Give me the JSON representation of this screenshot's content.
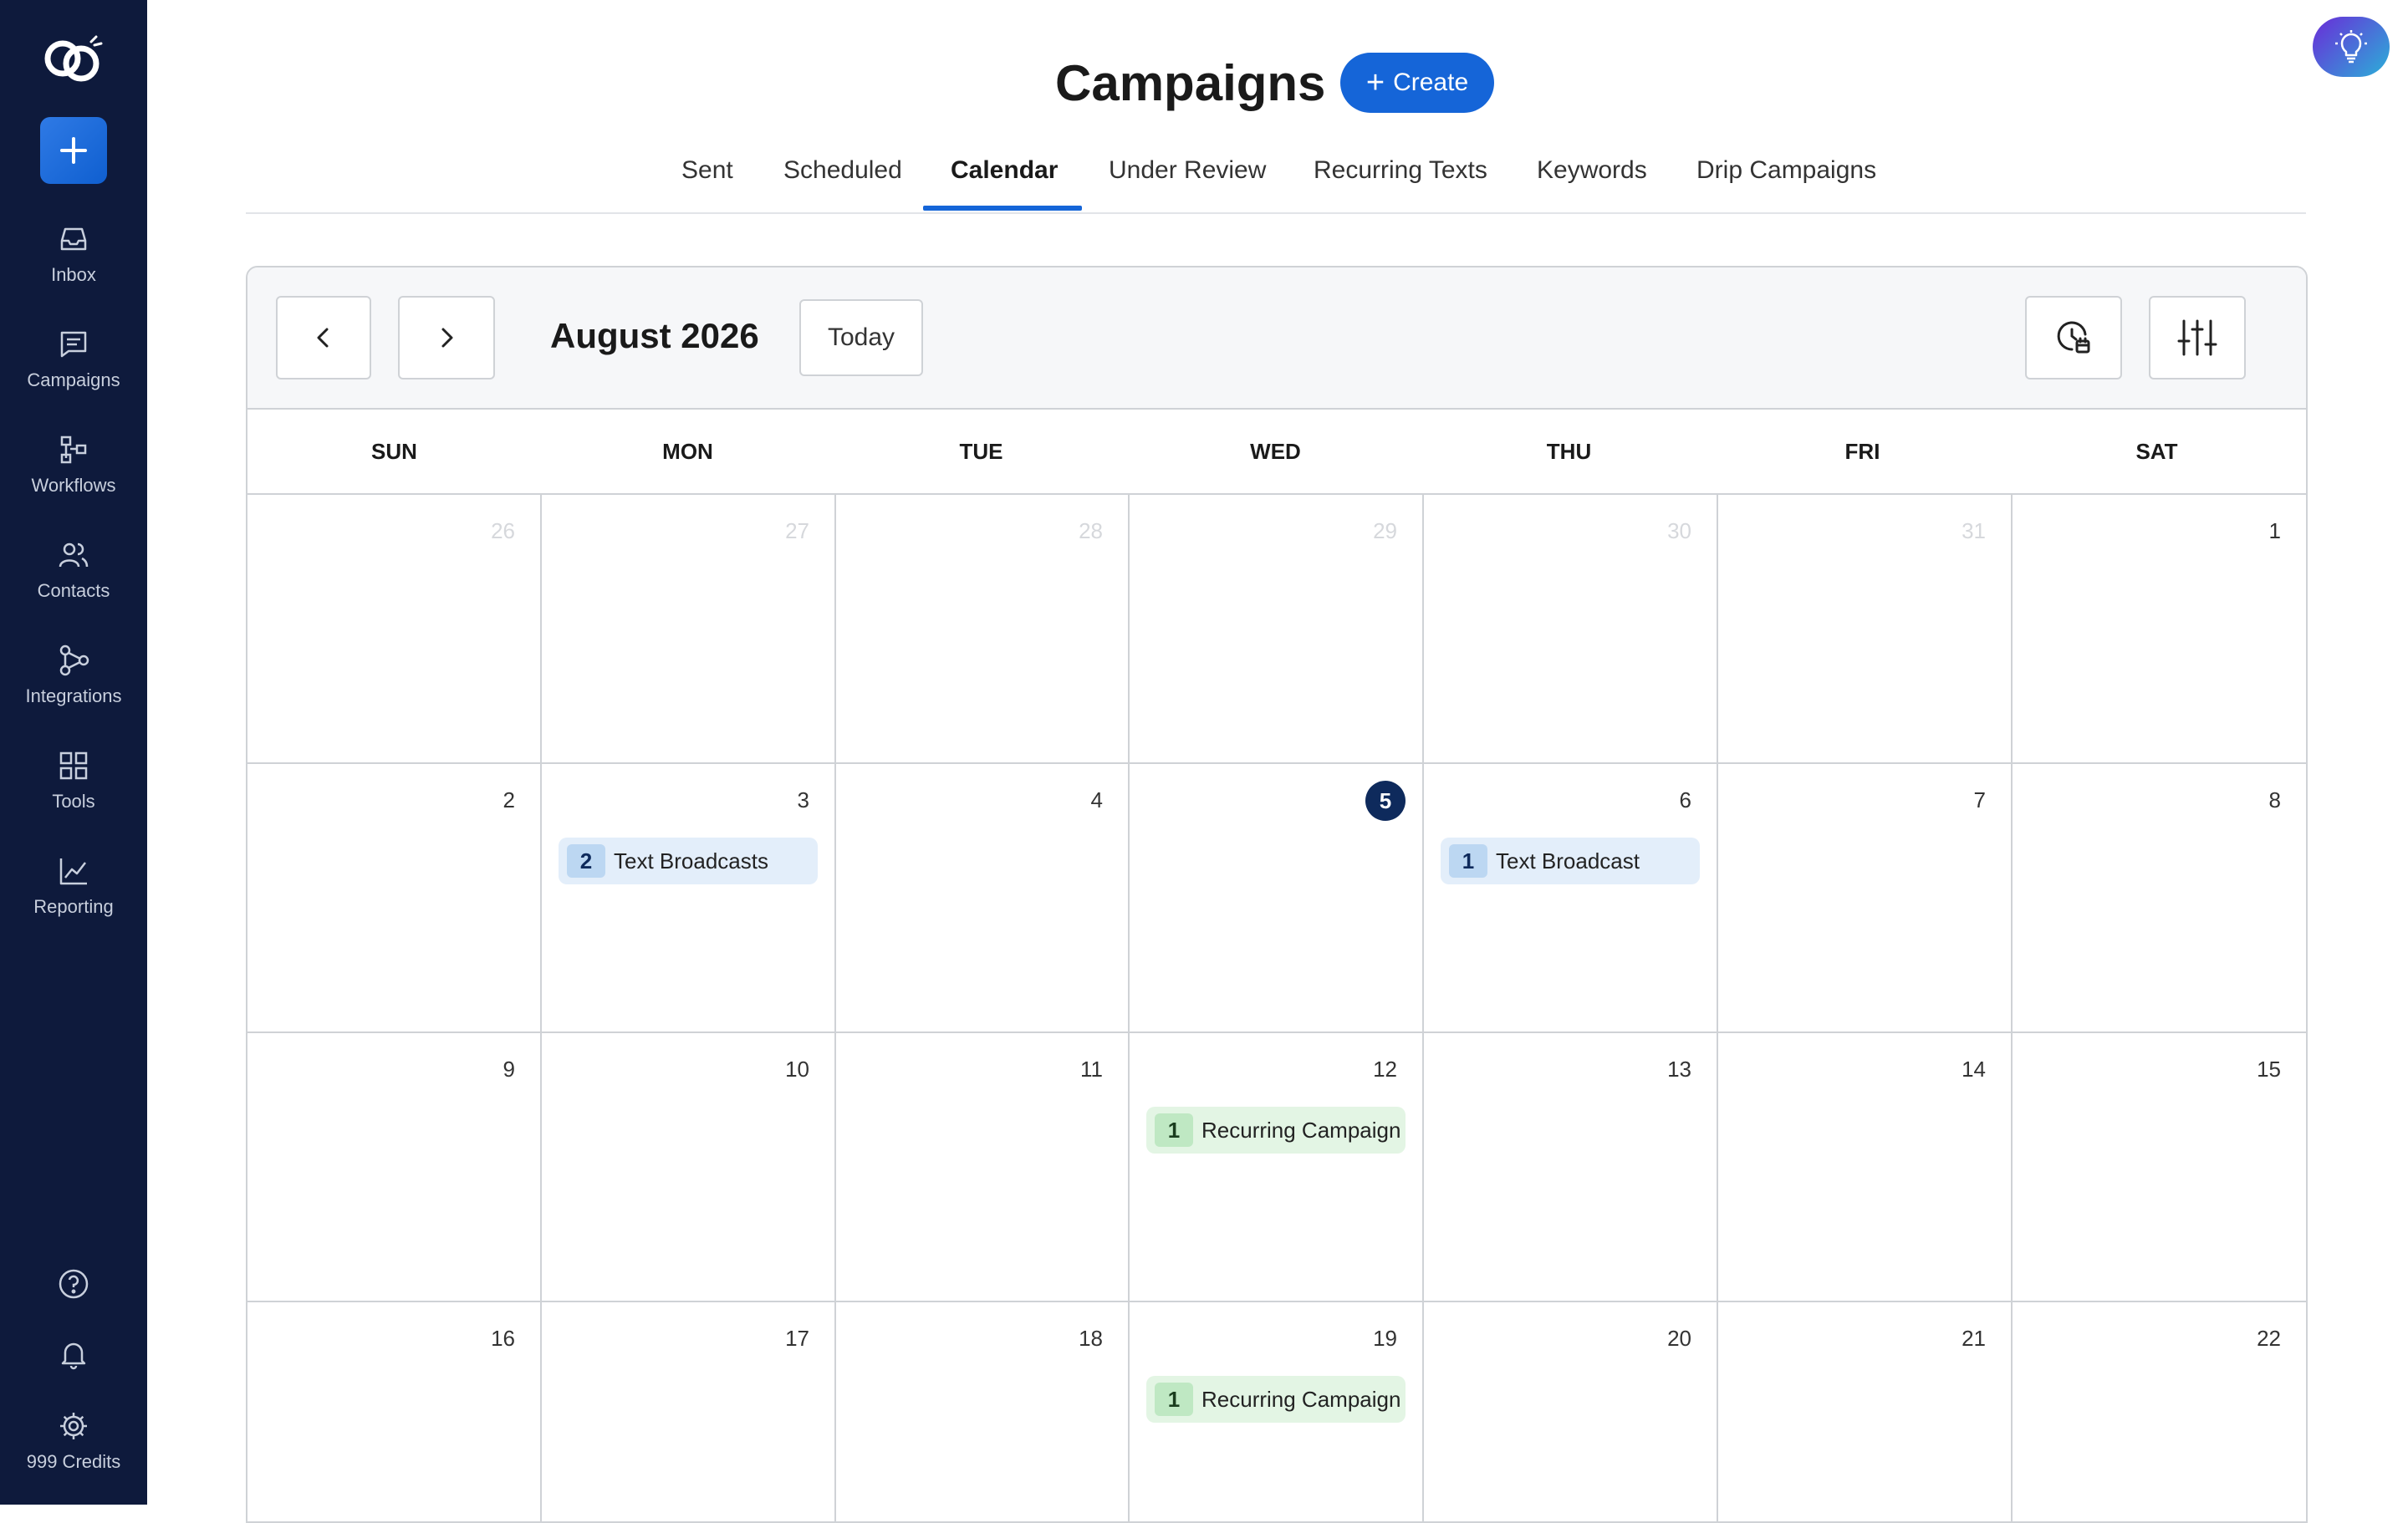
{
  "sidebar": {
    "items": [
      {
        "label": "Inbox",
        "icon": "inbox-icon"
      },
      {
        "label": "Campaigns",
        "icon": "chat-icon"
      },
      {
        "label": "Workflows",
        "icon": "workflow-icon"
      },
      {
        "label": "Contacts",
        "icon": "contacts-icon"
      },
      {
        "label": "Integrations",
        "icon": "integrations-icon"
      },
      {
        "label": "Tools",
        "icon": "grid-icon"
      },
      {
        "label": "Reporting",
        "icon": "chart-icon"
      }
    ],
    "credits": "999 Credits"
  },
  "header": {
    "title": "Campaigns",
    "create_label": "Create"
  },
  "tabs": [
    {
      "label": "Sent",
      "active": false
    },
    {
      "label": "Scheduled",
      "active": false
    },
    {
      "label": "Calendar",
      "active": true
    },
    {
      "label": "Under Review",
      "active": false
    },
    {
      "label": "Recurring Texts",
      "active": false
    },
    {
      "label": "Keywords",
      "active": false
    },
    {
      "label": "Drip Campaigns",
      "active": false
    }
  ],
  "calendar": {
    "month_label": "August 2026",
    "today_label": "Today",
    "weekdays": [
      "SUN",
      "MON",
      "TUE",
      "WED",
      "THU",
      "FRI",
      "SAT"
    ],
    "weeks": [
      [
        {
          "day": "26",
          "muted": true
        },
        {
          "day": "27",
          "muted": true
        },
        {
          "day": "28",
          "muted": true
        },
        {
          "day": "29",
          "muted": true
        },
        {
          "day": "30",
          "muted": true
        },
        {
          "day": "31",
          "muted": true
        },
        {
          "day": "1"
        }
      ],
      [
        {
          "day": "2"
        },
        {
          "day": "3",
          "event": {
            "count": "2",
            "label": "Text Broadcasts",
            "color": "blue"
          }
        },
        {
          "day": "4"
        },
        {
          "day": "5",
          "today": true
        },
        {
          "day": "6",
          "event": {
            "count": "1",
            "label": "Text Broadcast",
            "color": "blue"
          }
        },
        {
          "day": "7"
        },
        {
          "day": "8"
        }
      ],
      [
        {
          "day": "9"
        },
        {
          "day": "10"
        },
        {
          "day": "11"
        },
        {
          "day": "12",
          "event": {
            "count": "1",
            "label": "Recurring Campaign",
            "color": "green"
          }
        },
        {
          "day": "13"
        },
        {
          "day": "14"
        },
        {
          "day": "15"
        }
      ],
      [
        {
          "day": "16"
        },
        {
          "day": "17"
        },
        {
          "day": "18"
        },
        {
          "day": "19",
          "event": {
            "count": "1",
            "label": "Recurring Campaign",
            "color": "green"
          }
        },
        {
          "day": "20"
        },
        {
          "day": "21"
        },
        {
          "day": "22"
        }
      ]
    ]
  },
  "colors": {
    "sidebar_bg": "#0e1a3c",
    "accent": "#1565d8",
    "today_badge": "#0e2a5c",
    "event_blue": "#e3eefa",
    "event_green": "#e3f5e4"
  }
}
